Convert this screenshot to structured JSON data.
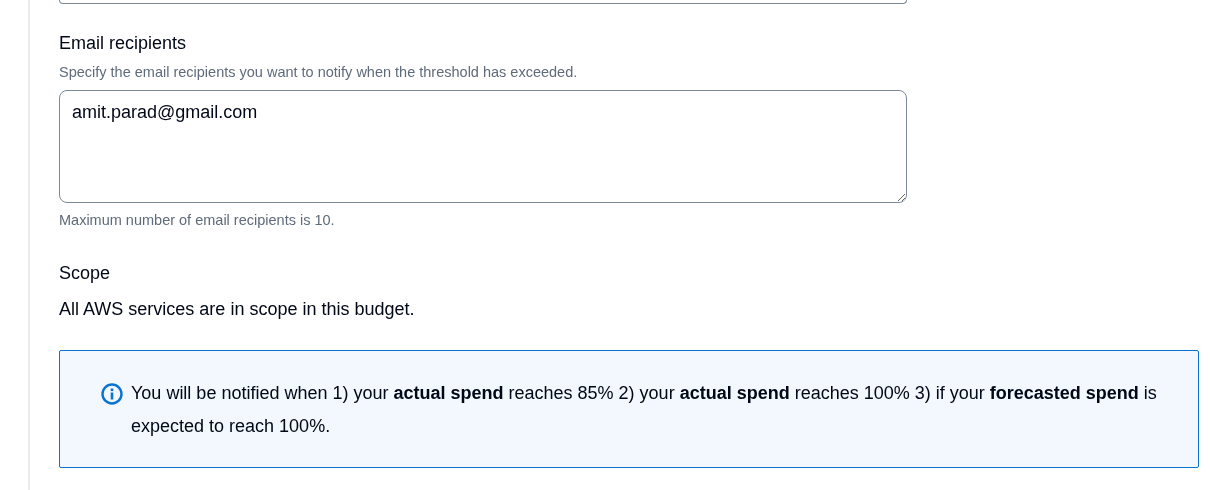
{
  "email_recipients": {
    "label": "Email recipients",
    "description": "Specify the email recipients you want to notify when the threshold has exceeded.",
    "value": "amit.parad@gmail.com",
    "constraint": "Maximum number of email recipients is 10."
  },
  "scope": {
    "label": "Scope",
    "text": "All AWS services are in scope in this budget."
  },
  "info_alert": {
    "text": "You will be notified when 1) your **actual spend** reaches 85% 2) your **actual spend** reaches 100% 3) if your **forecasted spend** is expected to reach 100%."
  }
}
